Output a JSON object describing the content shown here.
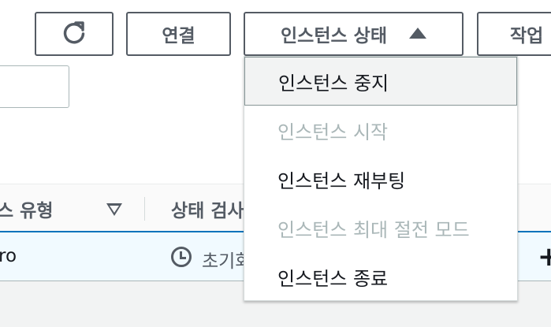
{
  "toolbar": {
    "connect_label": "연결",
    "instance_state_label": "인스턴스 상태",
    "actions_label": "작업"
  },
  "table": {
    "headers": [
      "스 유형",
      "상태 검사"
    ],
    "row": {
      "type": "ro",
      "status_check": "초기화"
    }
  },
  "instance_state_menu": {
    "items": [
      {
        "label": "인스턴스 중지",
        "enabled": true,
        "highlighted": true
      },
      {
        "label": "인스턴스 시작",
        "enabled": false
      },
      {
        "label": "인스턴스 재부팅",
        "enabled": true
      },
      {
        "label": "인스턴스 최대 절전 모드",
        "enabled": false
      },
      {
        "label": "인스턴스 종료",
        "enabled": true
      }
    ]
  },
  "icons": [
    "refresh-icon",
    "caret-up-icon",
    "filter-icon",
    "clock-icon",
    "plus-icon"
  ],
  "colors": {
    "button_border": "#545b64",
    "selected_row_bg": "#f1faff",
    "header_underline": "#0073bb",
    "disabled_text": "#aab7b8"
  }
}
